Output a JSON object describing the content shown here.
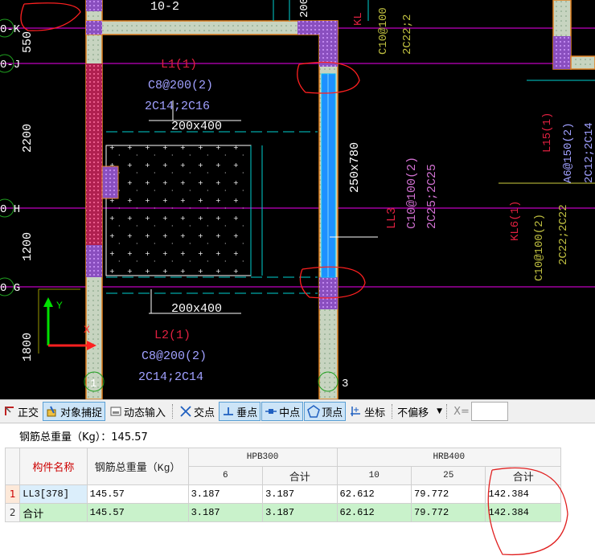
{
  "cad": {
    "dims": {
      "d550": "550",
      "d2200": "2200",
      "d1200": "1200",
      "d1800": "1800",
      "top_left": "10-2",
      "top_mid": "200"
    },
    "axis_labels": {
      "k": "0-K",
      "j": "0-J",
      "h": "0 H",
      "g": "0 G",
      "e1": "1",
      "e3": "3"
    },
    "beam_l1": {
      "name": "L1(1)",
      "stirrup": "C8@200(2)",
      "bars": "2C14;2C16",
      "section": "200x400"
    },
    "beam_l2": {
      "name": "L2(1)",
      "stirrup": "C8@200(2)",
      "bars": "2C14;2C14",
      "section": "200x400"
    },
    "beam_ll3": {
      "name": "LL3",
      "stirrup": "C10@100(2)",
      "bars": "2C25;2C25",
      "section": "250x780"
    },
    "beam_kl": {
      "name": "KL",
      "stirrup": "C10@100",
      "bars": "2C22;2"
    },
    "beam_l15": {
      "name": "L15(1)",
      "stirrup": "A6@150(2)",
      "bars": "2C12;2C14"
    },
    "beam_kl6": {
      "name": "KL6(1)",
      "stirrup": "C10@100(2)",
      "bars": "2C22;2C22"
    },
    "coord_axis": {
      "y": "Y",
      "x": "X"
    }
  },
  "toolbar": {
    "ortho": "正交",
    "osnap": "对象捕捉",
    "dynamic_input": "动态输入",
    "intersection": "交点",
    "perpendicular": "垂点",
    "midpoint": "中点",
    "vertex": "顶点",
    "coordinate": "坐标",
    "offset_mode": "不偏移",
    "x_label": "X="
  },
  "summary": {
    "total_weight": "钢筋总重量（Kg）：145.57"
  },
  "table": {
    "header": {
      "name": "构件名称",
      "total": "钢筋总重量（Kg）",
      "group1": "HPB300",
      "group2": "HRB400",
      "col_6": "6",
      "col_sub1": "合计",
      "col_10": "10",
      "col_25": "25",
      "col_sub2": "合计"
    },
    "rows": [
      {
        "idx": "1",
        "name": "LL3[378]",
        "total": "145.57",
        "h6": "3.187",
        "hsum": "3.187",
        "r10": "62.612",
        "r25": "79.772",
        "rsum": "142.384"
      },
      {
        "idx": "2",
        "name": "合计",
        "total": "145.57",
        "h6": "3.187",
        "hsum": "3.187",
        "r10": "62.612",
        "r25": "79.772",
        "rsum": "142.384"
      }
    ]
  }
}
